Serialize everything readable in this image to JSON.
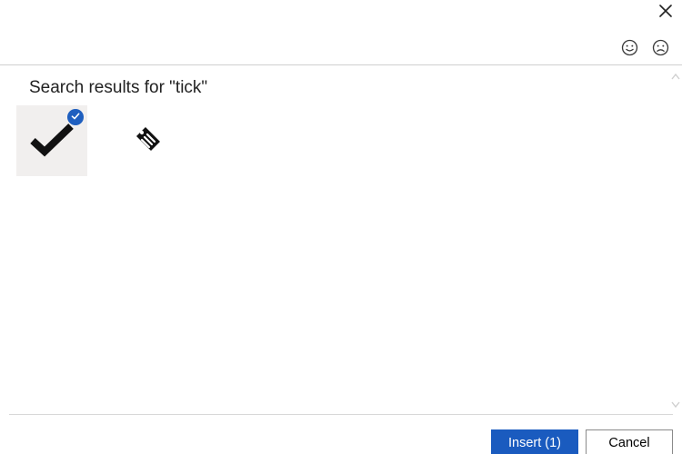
{
  "header": {
    "close_label": "Close",
    "feedback_happy_label": "Send positive feedback",
    "feedback_sad_label": "Send negative feedback"
  },
  "search": {
    "query": "tick",
    "heading": "Search results for \"tick\""
  },
  "results": [
    {
      "name": "checkmark-icon",
      "label": "Check mark",
      "selected": true
    },
    {
      "name": "price-tag-icon",
      "label": "Price tag / ticket",
      "selected": false
    }
  ],
  "selection": {
    "count": 1
  },
  "footer": {
    "insert_label": "Insert (1)",
    "cancel_label": "Cancel"
  },
  "colors": {
    "accent": "#1a5bbf",
    "badge": "#1f5fbf",
    "tile_selected_bg": "#f1efee"
  }
}
